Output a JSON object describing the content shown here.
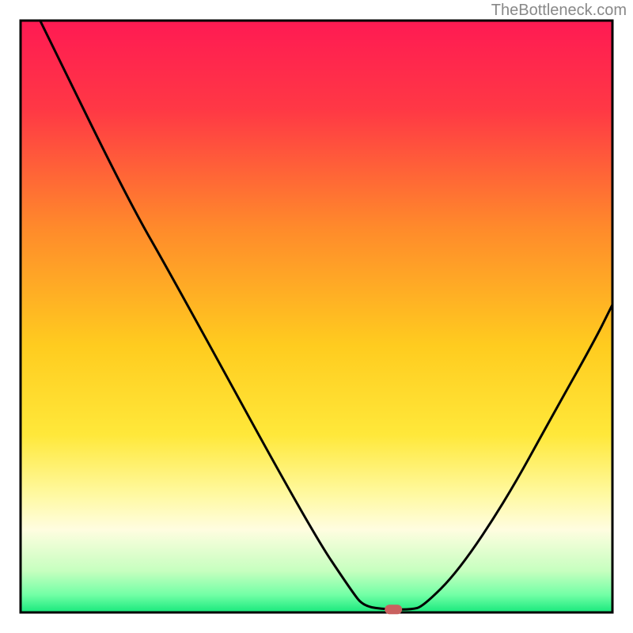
{
  "watermark": "TheBottleneck.com",
  "chart_data": {
    "type": "line",
    "title": "",
    "xlabel": "",
    "ylabel": "",
    "xlim": [
      0,
      100
    ],
    "ylim": [
      0,
      100
    ],
    "grid": false,
    "legend": false,
    "background_gradient": {
      "description": "vertical red→yellow→pale-yellow→green",
      "stops": [
        {
          "offset": 0.0,
          "color": "#ff1a53"
        },
        {
          "offset": 0.15,
          "color": "#ff3845"
        },
        {
          "offset": 0.35,
          "color": "#ff8a2b"
        },
        {
          "offset": 0.55,
          "color": "#ffcc1f"
        },
        {
          "offset": 0.7,
          "color": "#ffe83a"
        },
        {
          "offset": 0.8,
          "color": "#fff9a0"
        },
        {
          "offset": 0.86,
          "color": "#fffde0"
        },
        {
          "offset": 0.93,
          "color": "#c6ffbf"
        },
        {
          "offset": 0.97,
          "color": "#73ffa6"
        },
        {
          "offset": 1.0,
          "color": "#18e87c"
        }
      ]
    },
    "series": [
      {
        "name": "bottleneck-curve",
        "color": "#000000",
        "points": [
          {
            "x": 3.3,
            "y": 100.0
          },
          {
            "x": 18.0,
            "y": 70.0
          },
          {
            "x": 26.0,
            "y": 56.0
          },
          {
            "x": 49.0,
            "y": 14.0
          },
          {
            "x": 56.0,
            "y": 3.5
          },
          {
            "x": 58.0,
            "y": 1.0
          },
          {
            "x": 62.0,
            "y": 0.5
          },
          {
            "x": 66.0,
            "y": 0.5
          },
          {
            "x": 68.0,
            "y": 1.0
          },
          {
            "x": 74.0,
            "y": 7.0
          },
          {
            "x": 82.0,
            "y": 19.0
          },
          {
            "x": 90.0,
            "y": 33.5
          },
          {
            "x": 97.0,
            "y": 46.0
          },
          {
            "x": 100.0,
            "y": 52.0
          }
        ]
      }
    ],
    "marker": {
      "name": "optimum-point",
      "x": 63.0,
      "y": 0.5,
      "color": "#c9615f",
      "shape": "pill"
    }
  },
  "plot_frame": {
    "stroke": "#000000",
    "stroke_width": 3
  }
}
